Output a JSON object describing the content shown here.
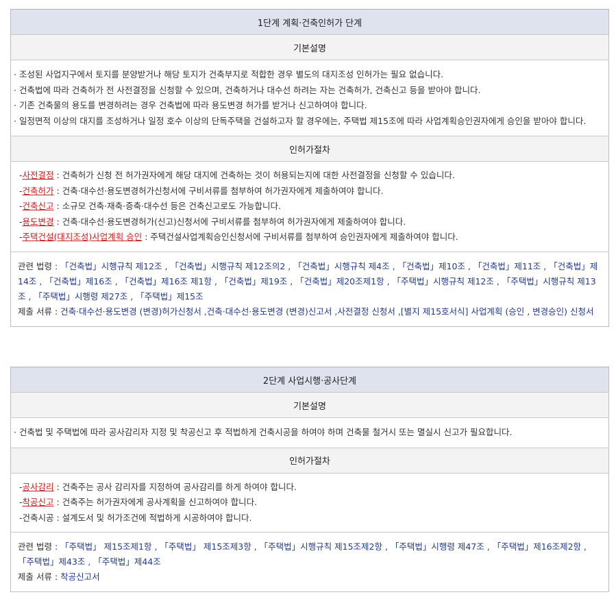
{
  "stage1": {
    "title": "1단계 계획·건축인허가 단계",
    "basic_header": "기본설명",
    "basic_lines": [
      "· 조성된 사업지구에서 토지를 분양받거나 해당 토지가 건축부지로 적합한 경우 별도의 대지조성 인허가는 필요 없습니다.",
      "· 건축법에 따라 건축허가 전 사전결정을 신청할 수 있으며, 건축하거나 대수선 하려는 자는 건축허가, 건축신고 등을 받아야 합니다.",
      "· 기존 건축물의 용도를 변경하려는 경우 건축법에 따라 용도변경 허가를 받거나 신고하여야 합니다.",
      "· 일정면적 이상의 대지를 조성하거나 일정 호수 이상의 단독주택을 건설하고자 할 경우에는, 주택법 제15조에 따라 사업계획승인권자에게 승인을 받아야 합니다."
    ],
    "proc_header": "인허가절차",
    "procedures": [
      {
        "prefix": "-",
        "link": "사전결정",
        "text": " : 건축허가 신청 전 허가권자에게 해당 대지에 건축하는 것이 허용되는지에 대한 사전결정을 신청할 수 있습니다."
      },
      {
        "prefix": "-",
        "link": "건축허가",
        "text": " : 건축·대수선·용도변경허가신청서에 구비서류를 첨부하여 허가권자에게 제출하여야 합니다."
      },
      {
        "prefix": "-",
        "link": "건축신고",
        "text": " : 소규모 건축·재축·증축·대수선 등은 건축신고로도 가능합니다."
      },
      {
        "prefix": "-",
        "link": "용도변경",
        "text": " : 건축·대수선·용도변경허가(신고)신청서에 구비서류를 첨부하여 허가권자에게 제출하여야 합니다."
      },
      {
        "prefix": "-",
        "link": "주택건설(대지조성)사업계획 승인",
        "text": " : 주택건설사업계획승인신청서에 구비서류를 첨부하여 승인권자에게 제출하여야 합니다."
      }
    ],
    "law_label": "관련 법령 : ",
    "law_text": "「건축법」시행규칙 제12조 , 「건축법」시행규칙 제12조의2 , 「건축법」시행규칙 제4조 , 「건축법」제10조 , 「건축법」제11조 , 「건축법」제14조 , 「건축법」제16조 , 「건축법」제16조 제1항 , 「건축법」제19조 , 「건축법」제20조제1항 , 「주택법」시행규칙 제12조 , 「주택법」시행규칙 제13조 , 「주택법」시행령 제27조 , 「주택법」제15조",
    "doc_label": "제출 서류 : ",
    "doc_text": "건축·대수선·용도변경 (변경)허가신청서 ,건축·대수선·용도변경 (변경)신고서 ,사전결정 신청서 ,[별지 제15호서식] 사업계획 (승인 , 변경승인) 신청서"
  },
  "stage2": {
    "title": "2단계 사업시행·공사단계",
    "basic_header": "기본설명",
    "basic_lines": [
      "· 건축법 및 주택법에 따라 공사감리자 지정 및 착공신고 후 적법하게 건축시공을 하여야 하며 건축물 철거시 또는 멸실시 신고가 필요합니다."
    ],
    "proc_header": "인허가절차",
    "procedures": [
      {
        "prefix": "-",
        "link": "공사감리",
        "text": " : 건축주는 공사 감리자를 지정하여 공사감리를 하게 하여야 합니다."
      },
      {
        "prefix": "-",
        "link": "착공신고",
        "text": " : 건축주는 허가권자에게 공사계획을 신고하여야 합니다."
      },
      {
        "prefix": "-",
        "link": "",
        "text": "건축시공 : 설계도서 및 허가조건에 적법하게 시공하여야 합니다."
      }
    ],
    "law_label": "관련 법령 : ",
    "law_text": "「주택법」 제15조제1항 , 「주택법」 제15조제3항 , 「주택법」시행규칙 제15조제2항 , 「주택법」시행령 제47조 , 「주택법」제16조제2항 , 「주택법」제43조 , 「주택법」제44조",
    "doc_label": "제출 서류 : ",
    "doc_text": "착공신고서"
  }
}
